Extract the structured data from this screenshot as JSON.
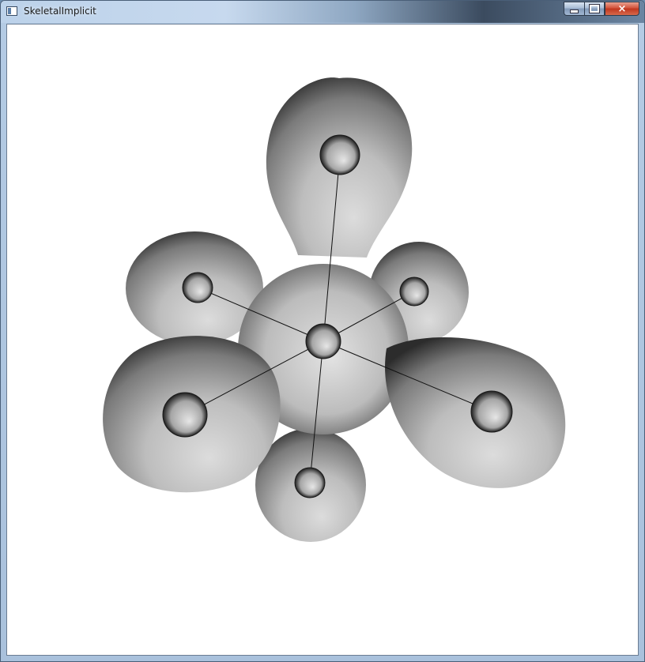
{
  "window": {
    "title": "SkeletalImplicit",
    "app_icon": "app-window-icon",
    "controls": {
      "minimize": "minimize-icon",
      "maximize": "maximize-icon",
      "close_label": "×"
    }
  },
  "colors": {
    "background": "#ffffff",
    "surface_light": "#d9d9d9",
    "surface_dark": "#2a2a2a",
    "skeleton_line": "#111111",
    "close_button": "#c9452b"
  }
}
